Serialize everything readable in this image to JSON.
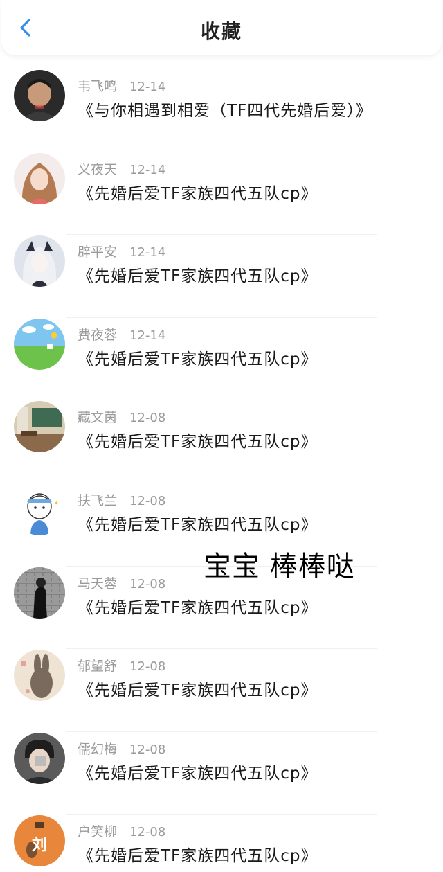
{
  "header": {
    "title": "收藏",
    "back_icon": "chevron-left-icon",
    "accent_color": "#2f8ff0"
  },
  "items": [
    {
      "name": "韦飞鸣",
      "date": "12-14",
      "title": "《与你相遇到相爱（TF四代先婚后爱）》"
    },
    {
      "name": "义夜天",
      "date": "12-14",
      "title": "《先婚后爱TF家族四代五队cp》"
    },
    {
      "name": "辟平安",
      "date": "12-14",
      "title": "《先婚后爱TF家族四代五队cp》"
    },
    {
      "name": "费夜蓉",
      "date": "12-14",
      "title": "《先婚后爱TF家族四代五队cp》"
    },
    {
      "name": "藏文茵",
      "date": "12-08",
      "title": "《先婚后爱TF家族四代五队cp》"
    },
    {
      "name": "扶飞兰",
      "date": "12-08",
      "title": "《先婚后爱TF家族四代五队cp》"
    },
    {
      "name": "马天蓉",
      "date": "12-08",
      "title": "《先婚后爱TF家族四代五队cp》"
    },
    {
      "name": "郁望舒",
      "date": "12-08",
      "title": "《先婚后爱TF家族四代五队cp》"
    },
    {
      "name": "儒幻梅",
      "date": "12-08",
      "title": "《先婚后爱TF家族四代五队cp》"
    },
    {
      "name": "户笑柳",
      "date": "12-08",
      "title": "《先婚后爱TF家族四代五队cp》"
    }
  ],
  "overlay_text": "宝宝 棒棒哒",
  "avatar_badge_text": "刘"
}
